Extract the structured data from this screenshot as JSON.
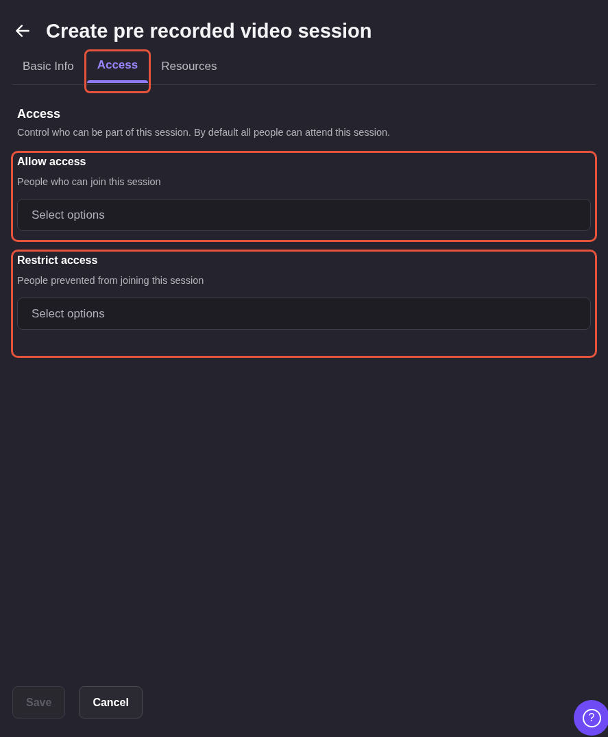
{
  "header": {
    "title": "Create pre recorded video session"
  },
  "tabs": [
    {
      "label": "Basic Info",
      "selected": false,
      "highlighted": false
    },
    {
      "label": "Access",
      "selected": true,
      "highlighted": true
    },
    {
      "label": "Resources",
      "selected": false,
      "highlighted": false
    }
  ],
  "section": {
    "title": "Access",
    "description": "Control who can be part of this session. By default all people can attend this session."
  },
  "fields": [
    {
      "label": "Allow access",
      "hint": "People who can join this session",
      "placeholder": "Select options",
      "highlighted": true
    },
    {
      "label": "Restrict access",
      "hint": "People prevented from joining this session",
      "placeholder": "Select options",
      "highlighted": true
    }
  ],
  "buttons": [
    {
      "label": "Save",
      "disabled": true
    },
    {
      "label": "Cancel",
      "disabled": false
    }
  ],
  "help_button": {
    "label": "?"
  }
}
